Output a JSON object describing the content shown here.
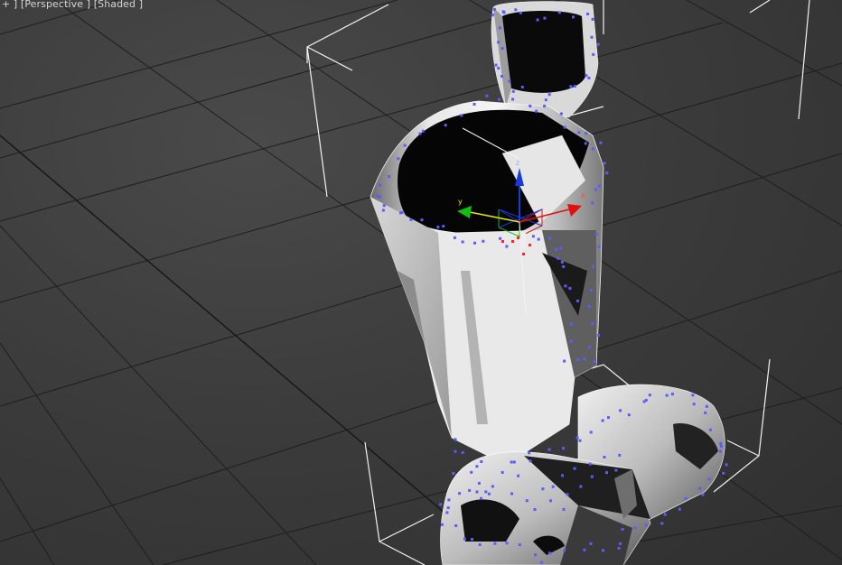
{
  "viewport": {
    "label": {
      "plus": "+",
      "sep1": " ] [",
      "view": "Perspective",
      "sep2": " ] [",
      "mode": "Shaded",
      "sep3": " ]"
    }
  },
  "gizmo": {
    "x_axis": "x",
    "y_axis": "y",
    "z_axis": "z"
  },
  "colors": {
    "grid": "#1c1c1c",
    "vertex": "#5a5cff",
    "bbox": "#ffffff",
    "x_axis": "#e01010",
    "y_axis": "#10c010",
    "z_axis": "#1a3ad8"
  }
}
